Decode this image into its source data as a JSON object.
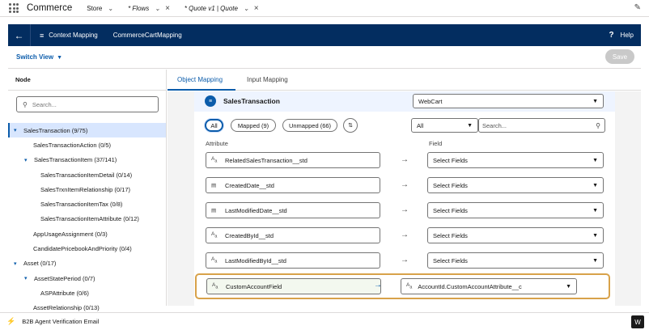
{
  "app": {
    "name": "Commerce",
    "tabs": [
      {
        "label": "Store",
        "italic": false
      },
      {
        "label": "* Flows",
        "italic": true
      },
      {
        "label": "* Quote v1 | Quote",
        "italic": true
      }
    ]
  },
  "header": {
    "context_label": "Context Mapping",
    "mapping_name": "CommerceCartMapping",
    "help_label": "Help"
  },
  "toolbar": {
    "switch_view_label": "Switch View",
    "save_label": "Save"
  },
  "left_panel": {
    "node_header": "Node",
    "search_placeholder": "Search...",
    "tree": [
      {
        "label": "SalesTransaction (9/75)",
        "level": 0,
        "toggle": "▾",
        "selected": true
      },
      {
        "label": "SalesTransactionAction (0/5)",
        "level": 1,
        "toggle": "",
        "selected": false
      },
      {
        "label": "SalesTransactionItem (37/141)",
        "level": 1,
        "toggle": "▾",
        "selected": false
      },
      {
        "label": "SalesTransactionItemDetail (0/14)",
        "level": 2,
        "toggle": "",
        "selected": false
      },
      {
        "label": "SalesTrxnItemRelationship (0/17)",
        "level": 2,
        "toggle": "",
        "selected": false
      },
      {
        "label": "SalesTransactionItemTax (0/8)",
        "level": 2,
        "toggle": "",
        "selected": false
      },
      {
        "label": "SalesTransactionItemAttribute (0/12)",
        "level": 2,
        "toggle": "",
        "selected": false
      },
      {
        "label": "AppUsageAssignment (0/3)",
        "level": 1,
        "toggle": "",
        "selected": false
      },
      {
        "label": "CandidatePricebookAndPriority (0/4)",
        "level": 1,
        "toggle": "",
        "selected": false
      },
      {
        "label": "Asset (0/17)",
        "level": 0,
        "toggle": "▾",
        "selected": false
      },
      {
        "label": "AssetStatePeriod (0/7)",
        "level": 1,
        "toggle": "▾",
        "selected": false
      },
      {
        "label": "ASPAttribute (0/6)",
        "level": 2,
        "toggle": "",
        "selected": false
      },
      {
        "label": "AssetRelationship (0/13)",
        "level": 1,
        "toggle": "",
        "selected": false
      }
    ]
  },
  "main": {
    "tabs": [
      {
        "label": "Object Mapping",
        "active": true
      },
      {
        "label": "Input Mapping",
        "active": false
      }
    ],
    "object_title": "SalesTransaction",
    "target_object": "WebCart",
    "filters": {
      "all_label": "All",
      "mapped_label": "Mapped (9)",
      "unmapped_label": "Unmapped (66)"
    },
    "field_filter_value": "All",
    "field_search_placeholder": "Search...",
    "columns": {
      "attribute": "Attribute",
      "field": "Field"
    },
    "rows": [
      {
        "attribute": "RelatedSalesTransaction__std",
        "icon": "text-icon",
        "field": "Select Fields"
      },
      {
        "attribute": "CreatedDate__std",
        "icon": "calendar-icon",
        "field": "Select Fields"
      },
      {
        "attribute": "LastModifiedDate__std",
        "icon": "calendar-icon",
        "field": "Select Fields"
      },
      {
        "attribute": "CreatedById__std",
        "icon": "text-icon",
        "field": "Select Fields"
      },
      {
        "attribute": "LastModifiedById__std",
        "icon": "text-icon",
        "field": "Select Fields"
      }
    ],
    "highlighted_row": {
      "attribute": "CustomAccountField",
      "field": "AccountId.CustomAccountAttribute__c"
    }
  },
  "bottom": {
    "utility_label": "B2B Agent Verification Email",
    "badge": "W"
  },
  "colors": {
    "brand_dark": "#032d60",
    "accent": "#0b5cab",
    "highlight_border": "#d8a24a"
  }
}
